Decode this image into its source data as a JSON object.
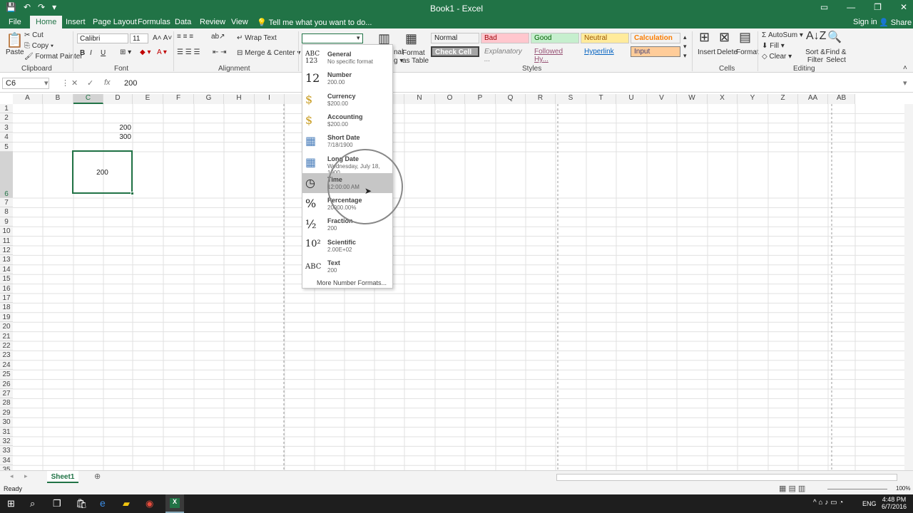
{
  "window": {
    "title": "Book1 - Excel",
    "signin": "Sign in",
    "share": "Share"
  },
  "tabs": [
    "File",
    "Home",
    "Insert",
    "Page Layout",
    "Formulas",
    "Data",
    "Review",
    "View"
  ],
  "tell_me": "Tell me what you want to do...",
  "clipboard": {
    "paste": "Paste",
    "cut": "Cut",
    "copy": "Copy",
    "format_painter": "Format Painter",
    "label": "Clipboard"
  },
  "font": {
    "name": "Calibri",
    "size": "11",
    "bold": "B",
    "italic": "I",
    "underline": "U",
    "label": "Font"
  },
  "alignment": {
    "wrap": "Wrap Text",
    "merge": "Merge & Center",
    "label": "Alignment"
  },
  "styles": {
    "label": "Styles",
    "cond_partial": "nal",
    "cond_partial2": "g",
    "format_as_table": "Format as Table",
    "cells": [
      {
        "text": "Normal",
        "bg": "#ffffff",
        "fg": "#222222"
      },
      {
        "text": "Bad",
        "bg": "#ffc7ce",
        "fg": "#9c0006"
      },
      {
        "text": "Good",
        "bg": "#c6efce",
        "fg": "#006100"
      },
      {
        "text": "Neutral",
        "bg": "#ffeb9c",
        "fg": "#9c5700"
      },
      {
        "text": "Calculation",
        "bg": "#f2f2f2",
        "fg": "#fa7d00"
      },
      {
        "text": "Check Cell",
        "bg": "#a5a5a5",
        "fg": "#ffffff"
      },
      {
        "text": "Explanatory ...",
        "bg": "#ffffff",
        "fg": "#7f7f7f"
      },
      {
        "text": "Followed Hy...",
        "bg": "#ffffff",
        "fg": "#954f72"
      },
      {
        "text": "Hyperlink",
        "bg": "#ffffff",
        "fg": "#0563c1"
      },
      {
        "text": "Input",
        "bg": "#ffcc99",
        "fg": "#3f3f76"
      }
    ]
  },
  "cells_group": {
    "insert": "Insert",
    "delete": "Delete",
    "format": "Format",
    "label": "Cells"
  },
  "editing": {
    "autosum": "AutoSum",
    "fill": "Fill",
    "clear": "Clear",
    "sort": "Sort & Filter",
    "find": "Find & Select",
    "label": "Editing"
  },
  "formula_bar": {
    "name_box": "C6",
    "value": "200"
  },
  "columns": [
    "A",
    "B",
    "C",
    "D",
    "E",
    "F",
    "G",
    "H",
    "I",
    "",
    "",
    "",
    "M",
    "N",
    "O",
    "P",
    "Q",
    "R",
    "S",
    "T",
    "U",
    "V",
    "W",
    "X",
    "Y",
    "Z",
    "AA",
    "AB"
  ],
  "rows": [
    "1",
    "2",
    "3",
    "4",
    "5",
    "6",
    "7",
    "8",
    "9",
    "10",
    "11",
    "12",
    "13",
    "14",
    "15",
    "16",
    "17",
    "18",
    "19",
    "20",
    "21",
    "22",
    "23",
    "24",
    "25",
    "26",
    "27",
    "28",
    "29",
    "30",
    "31",
    "32",
    "33",
    "34",
    "35"
  ],
  "cell_values": {
    "c3": "200",
    "c4": "300",
    "c6": "200"
  },
  "number_formats": [
    {
      "icon": "ABC 123",
      "label": "General",
      "example": "No specific format"
    },
    {
      "icon": "12",
      "label": "Number",
      "example": "200.00"
    },
    {
      "icon": "$",
      "label": "Currency",
      "example": "$200.00"
    },
    {
      "icon": "$",
      "label": "Accounting",
      "example": " $200.00"
    },
    {
      "icon": "▦",
      "label": "Short Date",
      "example": "7/18/1900"
    },
    {
      "icon": "▦",
      "label": "Long Date",
      "example": "Wednesday, July 18, 1900"
    },
    {
      "icon": "◷",
      "label": "Time",
      "example": "12:00:00 AM"
    },
    {
      "icon": "%",
      "label": "Percentage",
      "example": "20000.00%"
    },
    {
      "icon": "½",
      "label": "Fraction",
      "example": "200"
    },
    {
      "icon": "10²",
      "label": "Scientific",
      "example": "2.00E+02"
    },
    {
      "icon": "ABC",
      "label": "Text",
      "example": "200"
    }
  ],
  "more_formats": "More Number Formats...",
  "sheet": {
    "name": "Sheet1"
  },
  "status": {
    "ready": "Ready",
    "zoom": "100%"
  },
  "taskbar": {
    "time": "4:48 PM",
    "date": "6/7/2016",
    "lang": "ENG"
  }
}
